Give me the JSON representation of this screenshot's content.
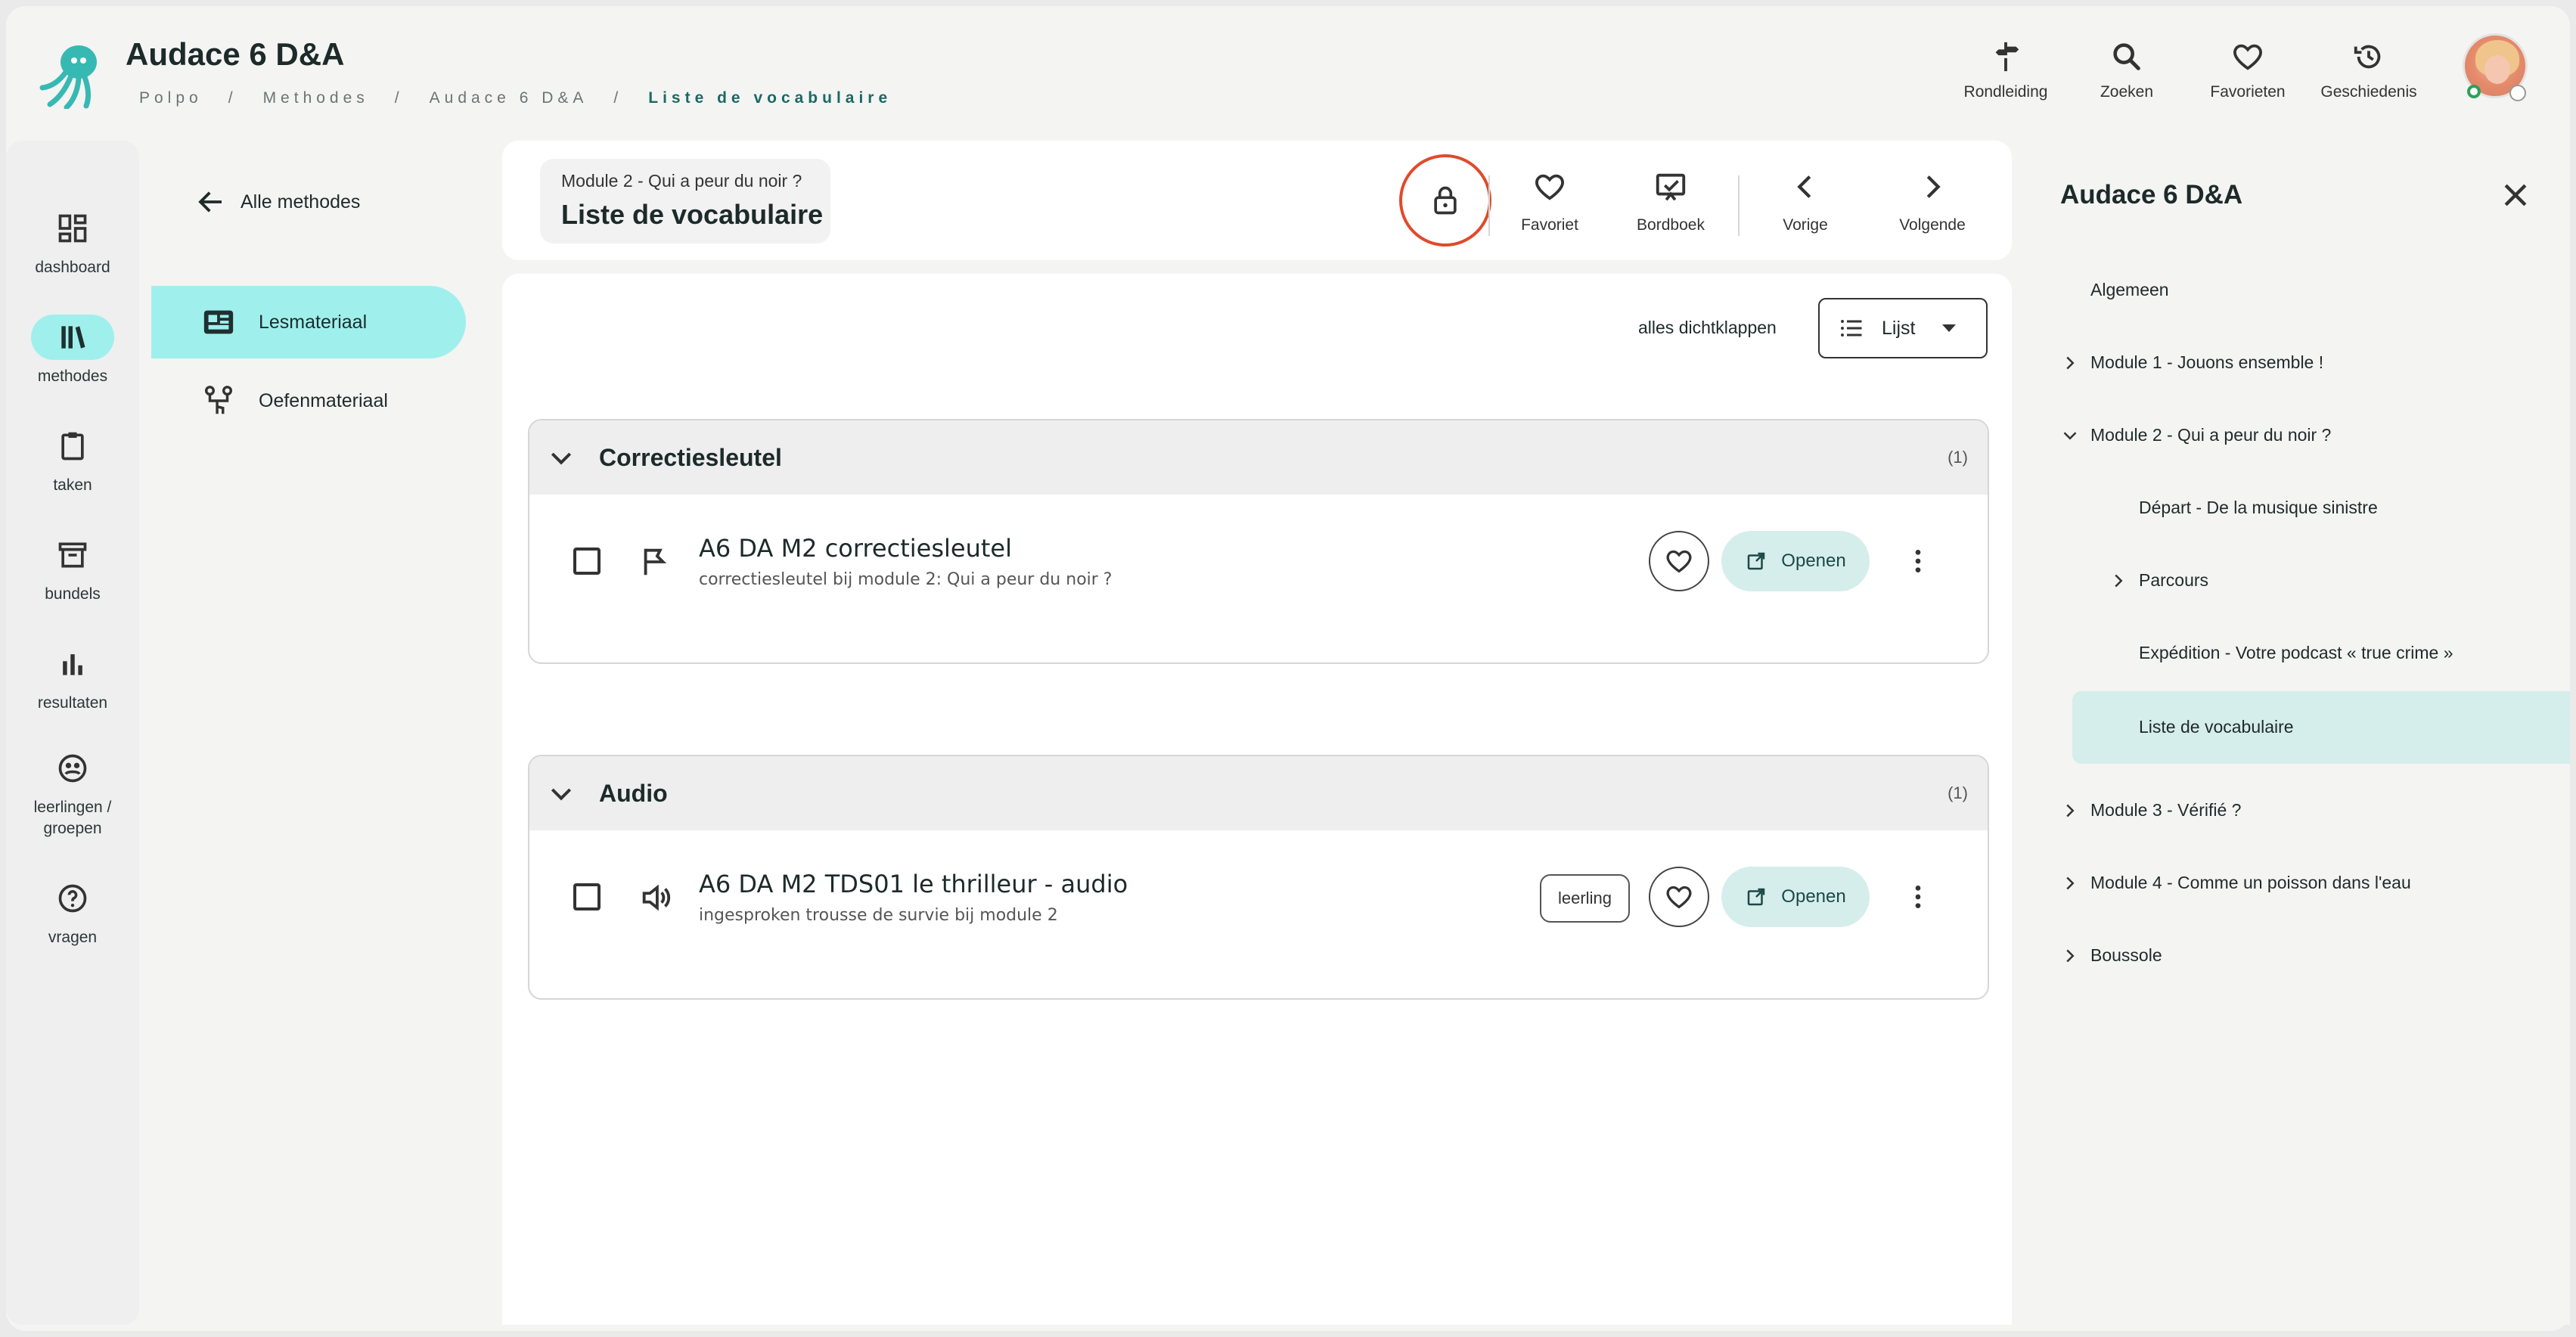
{
  "header": {
    "app_title": "Audace 6 D&A",
    "breadcrumb": [
      "Polpo",
      "Methodes",
      "Audace 6 D&A",
      "Liste de vocabulaire"
    ],
    "actions": [
      {
        "label": "Rondleiding",
        "icon": "signpost-icon"
      },
      {
        "label": "Zoeken",
        "icon": "search-icon"
      },
      {
        "label": "Favorieten",
        "icon": "heart-icon"
      },
      {
        "label": "Geschiedenis",
        "icon": "history-icon"
      }
    ]
  },
  "rail": {
    "items": [
      {
        "label": "dashboard",
        "icon": "dashboard-icon"
      },
      {
        "label": "methodes",
        "icon": "books-icon",
        "active": true
      },
      {
        "label": "taken",
        "icon": "clipboard-icon"
      },
      {
        "label": "bundels",
        "icon": "archive-icon"
      },
      {
        "label": "resultaten",
        "icon": "bar-chart-icon"
      },
      {
        "label": "leerlingen /",
        "label2": "groepen",
        "icon": "groups-icon"
      },
      {
        "label": "vragen",
        "icon": "help-icon"
      }
    ]
  },
  "nav2": {
    "back_label": "Alle methodes",
    "items": [
      {
        "label": "Lesmateriaal",
        "icon": "lesson-material-icon",
        "active": true
      },
      {
        "label": "Oefenmateriaal",
        "icon": "exercise-material-icon"
      }
    ]
  },
  "page": {
    "subtitle": "Module 2 - Qui a peur du noir ?",
    "title": "Liste de vocabulaire",
    "actions": [
      {
        "label": "Favoriet",
        "icon": "heart-icon"
      },
      {
        "label": "Bordboek",
        "icon": "board-icon"
      },
      {
        "label": "Vorige",
        "icon": "chevron-left-icon"
      },
      {
        "label": "Volgende",
        "icon": "chevron-right-icon"
      }
    ],
    "collapse_all": "alles dichtklappen",
    "view_select": "Lijst"
  },
  "sections": [
    {
      "title": "Correctiesleutel",
      "count": "(1)",
      "rows": [
        {
          "title": "A6 DA M2 correctiesleutel",
          "subtitle": "correctiesleutel bij module 2: Qui a peur du noir ?",
          "icon": "flag-icon",
          "badge": "",
          "open_label": "Openen"
        }
      ]
    },
    {
      "title": "Audio",
      "count": "(1)",
      "rows": [
        {
          "title": "A6 DA M2 TDS01 le thrilleur - audio",
          "subtitle": "ingesproken trousse de survie bij module 2",
          "icon": "speaker-icon",
          "badge": "leerling",
          "open_label": "Openen"
        }
      ]
    }
  ],
  "panel": {
    "title": "Audace 6 D&A",
    "tree": [
      {
        "label": "Algemeen",
        "level": 0,
        "expander": "none"
      },
      {
        "label": "Module 1 - Jouons ensemble !",
        "level": 0,
        "expander": "collapsed"
      },
      {
        "label": "Module 2 - Qui a peur du noir ?",
        "level": 0,
        "expander": "expanded"
      },
      {
        "label": "Départ - De la musique sinistre",
        "level": 1,
        "expander": "none"
      },
      {
        "label": "Parcours",
        "level": 1,
        "expander": "collapsed"
      },
      {
        "label": "Expédition - Votre podcast « true crime »",
        "level": 1,
        "expander": "none"
      },
      {
        "label": "Liste de vocabulaire",
        "level": 1,
        "expander": "none",
        "active": true
      },
      {
        "label": "Module 3 - Vérifié ?",
        "level": 0,
        "expander": "collapsed"
      },
      {
        "label": "Module 4 - Comme un poisson dans l'eau",
        "level": 0,
        "expander": "collapsed"
      },
      {
        "label": "Boussole",
        "level": 0,
        "expander": "collapsed"
      }
    ]
  },
  "colors": {
    "accent": "#9ff0ec",
    "accent_soft": "#d5eeeb",
    "lock_ring": "#e04a2b",
    "breadcrumb_current": "#186a66"
  }
}
